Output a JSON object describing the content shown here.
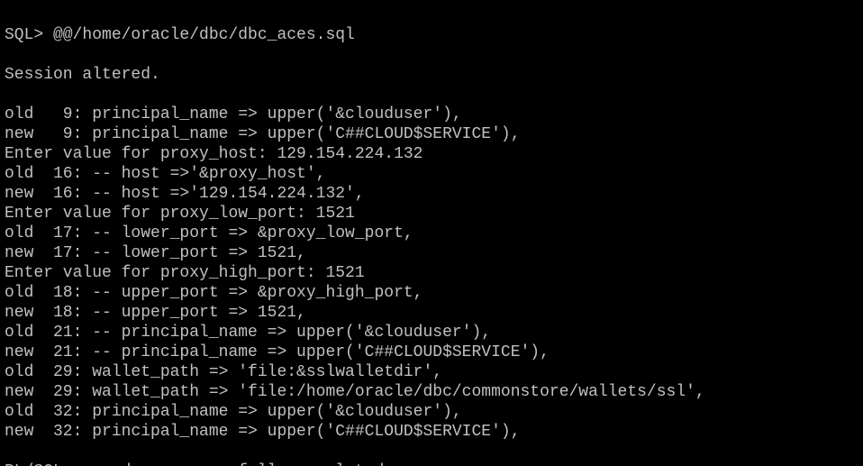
{
  "colors": {
    "background": "#000000",
    "foreground": "#c0c0c0"
  },
  "terminal": {
    "lines": [
      "SQL> @@/home/oracle/dbc/dbc_aces.sql",
      "",
      "Session altered.",
      "",
      "old   9: principal_name => upper('&clouduser'),",
      "new   9: principal_name => upper('C##CLOUD$SERVICE'),",
      "Enter value for proxy_host: 129.154.224.132",
      "old  16: -- host =>'&proxy_host',",
      "new  16: -- host =>'129.154.224.132',",
      "Enter value for proxy_low_port: 1521",
      "old  17: -- lower_port => &proxy_low_port,",
      "new  17: -- lower_port => 1521,",
      "Enter value for proxy_high_port: 1521",
      "old  18: -- upper_port => &proxy_high_port,",
      "new  18: -- upper_port => 1521,",
      "old  21: -- principal_name => upper('&clouduser'),",
      "new  21: -- principal_name => upper('C##CLOUD$SERVICE'),",
      "old  29: wallet_path => 'file:&sslwalletdir',",
      "new  29: wallet_path => 'file:/home/oracle/dbc/commonstore/wallets/ssl',",
      "old  32: principal_name => upper('&clouduser'),",
      "new  32: principal_name => upper('C##CLOUD$SERVICE'),",
      "",
      "PL/SQL procedure successfully completed."
    ]
  }
}
